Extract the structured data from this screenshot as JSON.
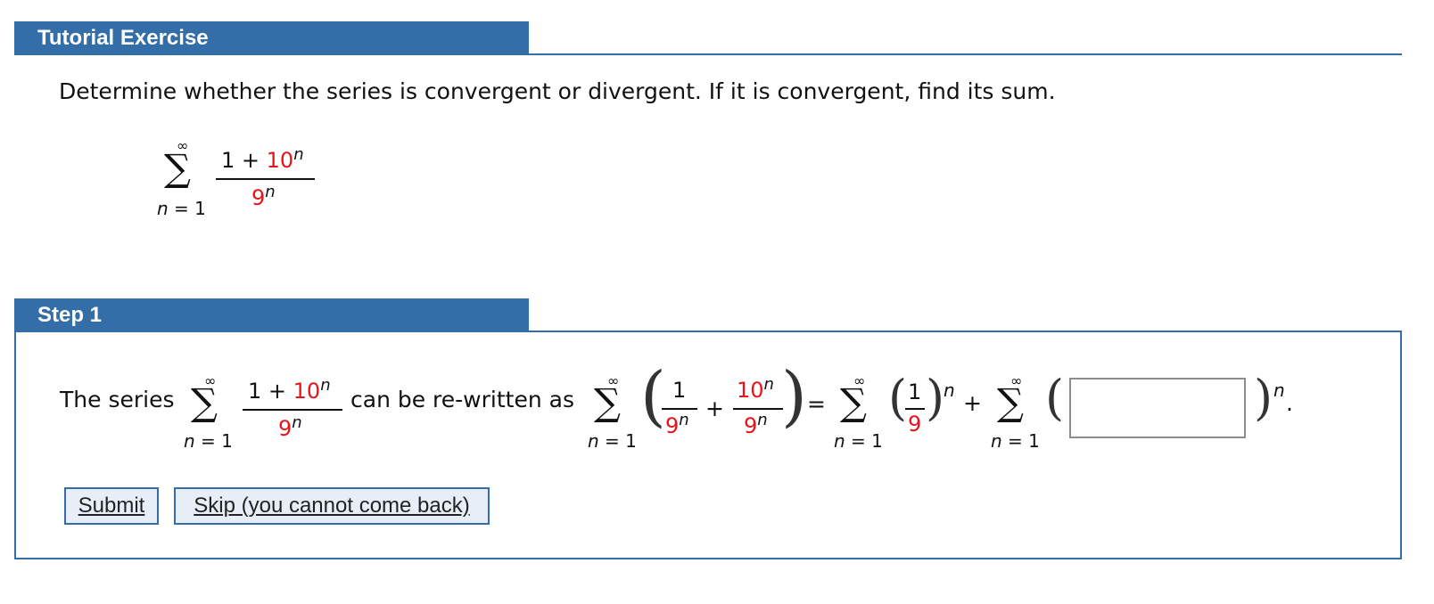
{
  "header": {
    "title": "Tutorial Exercise"
  },
  "question": {
    "text": "Determine whether the series is convergent or divergent. If it is convergent, find its sum."
  },
  "series_main": {
    "upper": "∞",
    "sigma": "∑",
    "lower": "n = 1",
    "numerator_prefix": "1 + ",
    "numerator_red": "10",
    "exponent": "n",
    "denominator_red": "9"
  },
  "step1": {
    "title": "Step 1",
    "prefix_text": "The series",
    "middle_text": "can be re-written as",
    "equals": "=",
    "plus": "+",
    "one": "1",
    "nine": "9",
    "ten": "10",
    "exponent": "n",
    "period": "."
  },
  "answer": {
    "value": ""
  },
  "buttons": {
    "submit_label": "Submit",
    "skip_label": "Skip (you cannot come back)"
  },
  "colors": {
    "header_bg": "#336ea8",
    "highlight": "#e8141a"
  }
}
